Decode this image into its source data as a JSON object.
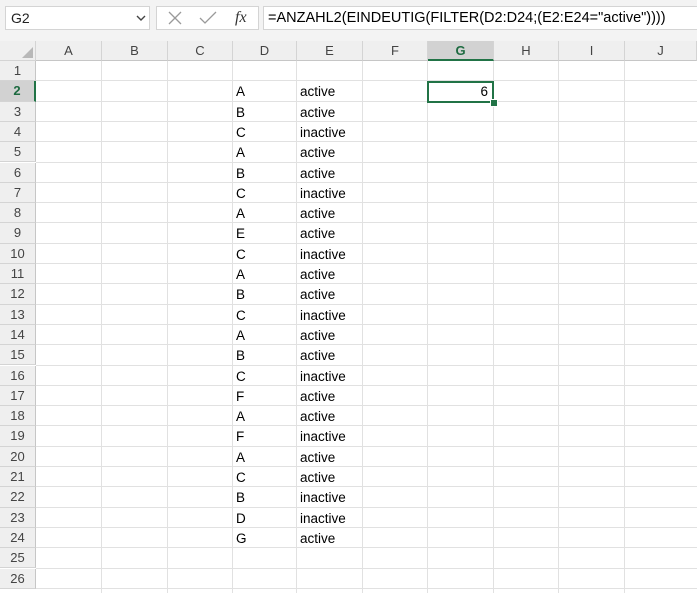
{
  "name_box": {
    "value": "G2"
  },
  "formula_bar": {
    "fx_label": "fx",
    "formula": "=ANZAHL2(EINDEUTIG(FILTER(D2:D24;(E2:E24=\"active\"))))"
  },
  "columns": [
    "A",
    "B",
    "C",
    "D",
    "E",
    "F",
    "G",
    "H",
    "I",
    "J"
  ],
  "selected_column": "G",
  "rows": [
    "1",
    "2",
    "3",
    "4",
    "5",
    "6",
    "7",
    "8",
    "9",
    "10",
    "11",
    "12",
    "13",
    "14",
    "15",
    "16",
    "17",
    "18",
    "19",
    "20",
    "21",
    "22",
    "23",
    "24",
    "25",
    "26"
  ],
  "selected_row": "2",
  "data_rows": [
    {
      "row": "2",
      "d": "A",
      "e": "active"
    },
    {
      "row": "3",
      "d": "B",
      "e": "active"
    },
    {
      "row": "4",
      "d": "C",
      "e": "inactive"
    },
    {
      "row": "5",
      "d": "A",
      "e": "active"
    },
    {
      "row": "6",
      "d": "B",
      "e": "active"
    },
    {
      "row": "7",
      "d": "C",
      "e": "inactive"
    },
    {
      "row": "8",
      "d": "A",
      "e": "active"
    },
    {
      "row": "9",
      "d": "E",
      "e": "active"
    },
    {
      "row": "10",
      "d": "C",
      "e": "inactive"
    },
    {
      "row": "11",
      "d": "A",
      "e": "active"
    },
    {
      "row": "12",
      "d": "B",
      "e": "active"
    },
    {
      "row": "13",
      "d": "C",
      "e": "inactive"
    },
    {
      "row": "14",
      "d": "A",
      "e": "active"
    },
    {
      "row": "15",
      "d": "B",
      "e": "active"
    },
    {
      "row": "16",
      "d": "C",
      "e": "inactive"
    },
    {
      "row": "17",
      "d": "F",
      "e": "active"
    },
    {
      "row": "18",
      "d": "A",
      "e": "active"
    },
    {
      "row": "19",
      "d": "F",
      "e": "inactive"
    },
    {
      "row": "20",
      "d": "A",
      "e": "active"
    },
    {
      "row": "21",
      "d": "C",
      "e": "active"
    },
    {
      "row": "22",
      "d": "B",
      "e": "inactive"
    },
    {
      "row": "23",
      "d": "D",
      "e": "inactive"
    },
    {
      "row": "24",
      "d": "G",
      "e": "active"
    }
  ],
  "selected_cell": {
    "ref": "G2",
    "value": "6"
  },
  "colors": {
    "accent": "#217346",
    "header_bg": "#efefef",
    "gridline": "#e1e1e1"
  }
}
